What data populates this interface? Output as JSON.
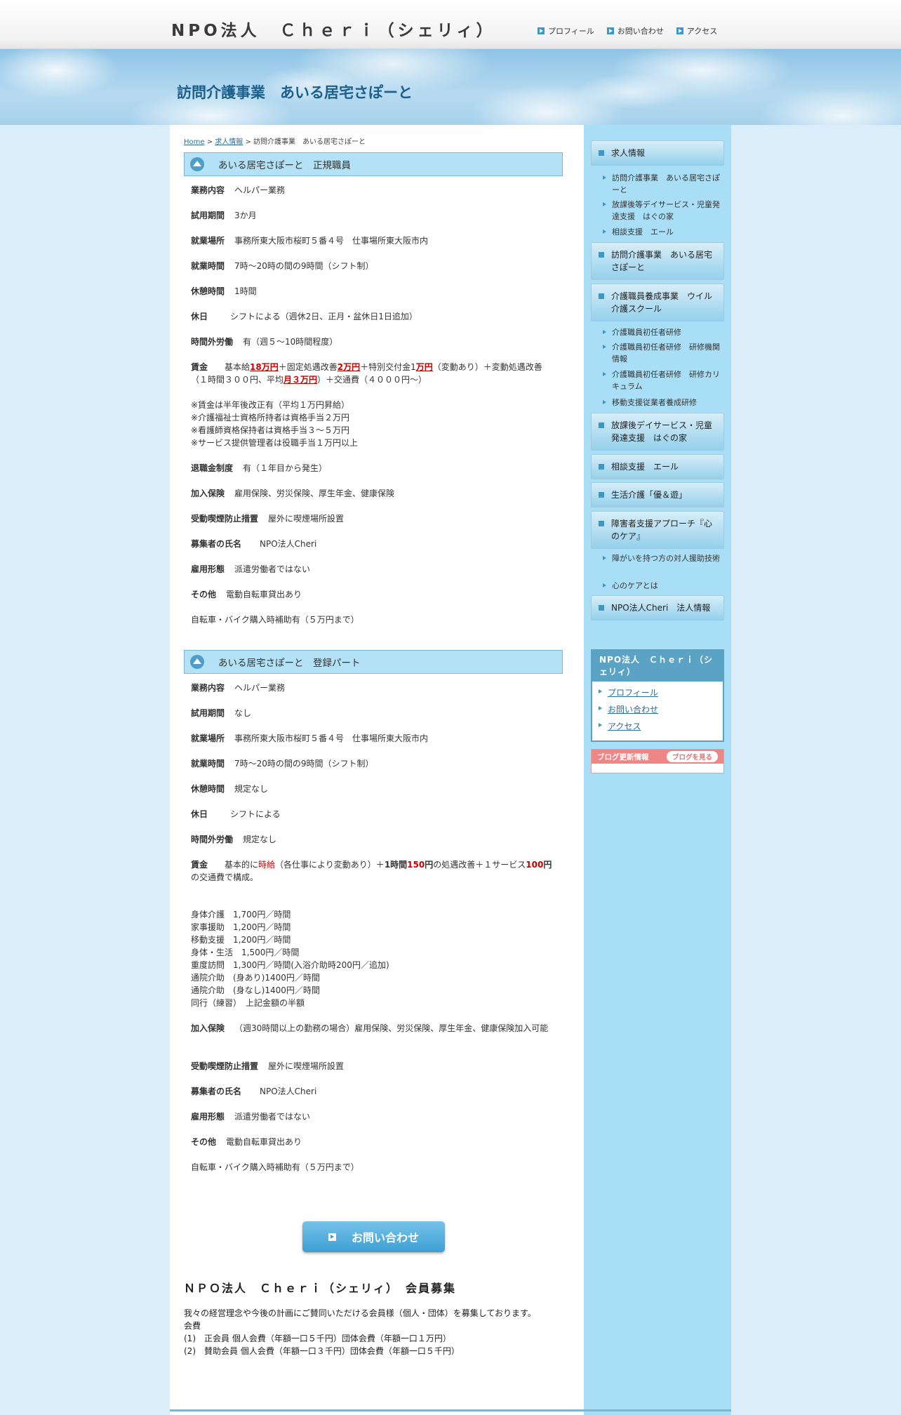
{
  "header": {
    "site_title": "NPO法人　Ｃｈｅｒｉ（シェリィ）",
    "nav": [
      "プロフィール",
      "お問い合わせ",
      "アクセス"
    ]
  },
  "banner": {
    "title": "訪問介護事業　あいる居宅さぽーと"
  },
  "breadcrumb": {
    "home": "Home",
    "sep1": " > ",
    "recruit": "求人情報",
    "sep2": " > ",
    "current": "訪問介護事業　あいる居宅さぽーと"
  },
  "section1": {
    "title": "あいる居宅さぽーと　正規職員",
    "rows": [
      {
        "label": "業務内容",
        "value": "ヘルパー業務"
      },
      {
        "label": "試用期間",
        "value": "3か月"
      },
      {
        "label": "就業場所",
        "value": "事務所東大阪市桜町５番４号　仕事場所東大阪市内"
      },
      {
        "label": "就業時間",
        "value": "7時～20時の間の9時間（シフト制）"
      },
      {
        "label": "休憩時間",
        "value": "1時間"
      },
      {
        "label": "休日",
        "value": "シフトによる（週休2日、正月・盆休日1日追加）"
      },
      {
        "label": "時間外労働",
        "value": "有（週５～10時間程度）"
      }
    ],
    "wage": {
      "label": "賃金",
      "t1": "基本給",
      "r1": "18万円",
      "t2": "＋固定処遇改善",
      "r2": "2万円",
      "t3": "＋特別交付金1",
      "r3": "万円",
      "t4": "（変動あり）＋変動処遇改善（１時間３００円、平均",
      "r4": "月３万円",
      "t5": "）＋交通費（４０００円～）"
    },
    "notes": [
      "※賃金は半年後改正有（平均１万円昇給）",
      "※介護福祉士資格所持者は資格手当２万円",
      "※看護師資格保持者は資格手当３～５万円",
      "※サービス提供管理者は役職手当１万円以上"
    ],
    "rows2": [
      {
        "label": "退職金制度",
        "value": "有（１年目から発生）"
      },
      {
        "label": "加入保険",
        "value": "雇用保険、労災保険、厚生年金、健康保険"
      },
      {
        "label": "受動喫煙防止措置",
        "value": "屋外に喫煙場所設置"
      },
      {
        "label": "募集者の氏名",
        "value": "　NPO法人Cheri"
      },
      {
        "label": "雇用形態",
        "value": "派遣労働者ではない"
      },
      {
        "label": "その他",
        "value": "電動自転車貸出あり"
      }
    ],
    "extra": "自転車・バイク購入時補助有（５万円まで）"
  },
  "section2": {
    "title": "あいる居宅さぽーと　登録パート",
    "rows": [
      {
        "label": "業務内容",
        "value": "ヘルパー業務"
      },
      {
        "label": "試用期間",
        "value": "なし"
      },
      {
        "label": "就業場所",
        "value": "事務所東大阪市桜町５番４号　仕事場所東大阪市内"
      },
      {
        "label": "就業時間",
        "value": "7時～20時の間の9時間（シフト制）"
      },
      {
        "label": "休憩時間",
        "value": "規定なし"
      },
      {
        "label": "休日",
        "value": "シフトによる"
      },
      {
        "label": "時間外労働",
        "value": "規定なし"
      }
    ],
    "wage": {
      "label": "賃金",
      "t1": "基本的に",
      "r1": "時給",
      "t2": "（各仕事により変動あり）＋",
      "b1": "1時間",
      "r2": "150",
      "b2": "円",
      "t3": "の処遇改善＋１サービス",
      "r3": "100",
      "b3": "円",
      "t4": "の交通費で構成。"
    },
    "hourly": [
      "身体介護　1,700円／時間",
      "家事援助　1,200円／時間",
      "移動支援　1,200円／時間",
      "身体・生活　1,500円／時間",
      "重度訪問　1,300円／時間(入浴介助時200円／追加)",
      "通院介助　(身あり)1400円／時間",
      "通院介助　(身なし)1400円／時間",
      "同行（練習）　上記金額の半額"
    ],
    "insurance": {
      "label": "加入保険",
      "value": "（週30時間以上の勤務の場合）雇用保険、労災保険、厚生年金、健康保険加入可能"
    },
    "rows2": [
      {
        "label": "受動喫煙防止措置",
        "value": "屋外に喫煙場所設置"
      },
      {
        "label": "募集者の氏名",
        "value": "　NPO法人Cheri"
      },
      {
        "label": "雇用形態",
        "value": "派遣労働者ではない"
      },
      {
        "label": "その他",
        "value": "電動自転車貸出あり"
      }
    ],
    "extra": "自転車・バイク購入時補助有（５万円まで）"
  },
  "contact_button": "お問い合わせ",
  "member": {
    "title": "ＮＰＯ法人　Ｃｈｅｒｉ（シェリィ）　会員募集",
    "lines": [
      "我々の経営理念や今後の計画にご賛同いただける会員様（個人・団体）を募集しております。",
      "会費",
      "(1)　正会員 個人会費（年額一口５千円）団体会費（年額一口１万円）",
      "(2)　賛助会員 個人会費（年額一口３千円）団体会費（年額一口５千円）"
    ]
  },
  "sidebar": {
    "nav": [
      {
        "label": "求人情報",
        "subs": [
          "訪問介護事業　あいる居宅さぽーと",
          "放課後等デイサービス・児童発達支援　はぐの家",
          "相談支援　エール"
        ]
      },
      {
        "label": "訪問介護事業　あいる居宅さぽーと",
        "subs": []
      },
      {
        "label": "介護職員養成事業　ウイル介護スクール",
        "subs": [
          "介護職員初任者研修",
          "介護職員初任者研修　研修機関情報",
          "介護職員初任者研修　研修カリキュラム",
          "移動支援従業者養成研修"
        ]
      },
      {
        "label": "放課後デイサービス・児童発達支援　はぐの家",
        "subs": []
      },
      {
        "label": "相談支援　エール",
        "subs": []
      },
      {
        "label": "生活介護「優＆遊」",
        "subs": []
      },
      {
        "label": "障害者支援アプローチ『心のケア』",
        "subs": [
          "障がいを持つ方の対人援助技術",
          "心のケアとは"
        ]
      },
      {
        "label": "NPO法人Cheri　法人情報",
        "subs": []
      }
    ],
    "npo_box": {
      "title": "NPO法人　Ｃｈｅｒｉ（シェリィ）",
      "links": [
        "プロフィール",
        "お問い合わせ",
        "アクセス"
      ]
    },
    "blog": {
      "title": "ブログ更新情報",
      "button": "ブログを見る"
    }
  },
  "colors": {
    "accent": "#3d97c5",
    "heading": "#1b5f8c",
    "section_bg": "#b3e2f6",
    "sidebar_bg": "#a9dff6",
    "highlight": "#c40000"
  }
}
